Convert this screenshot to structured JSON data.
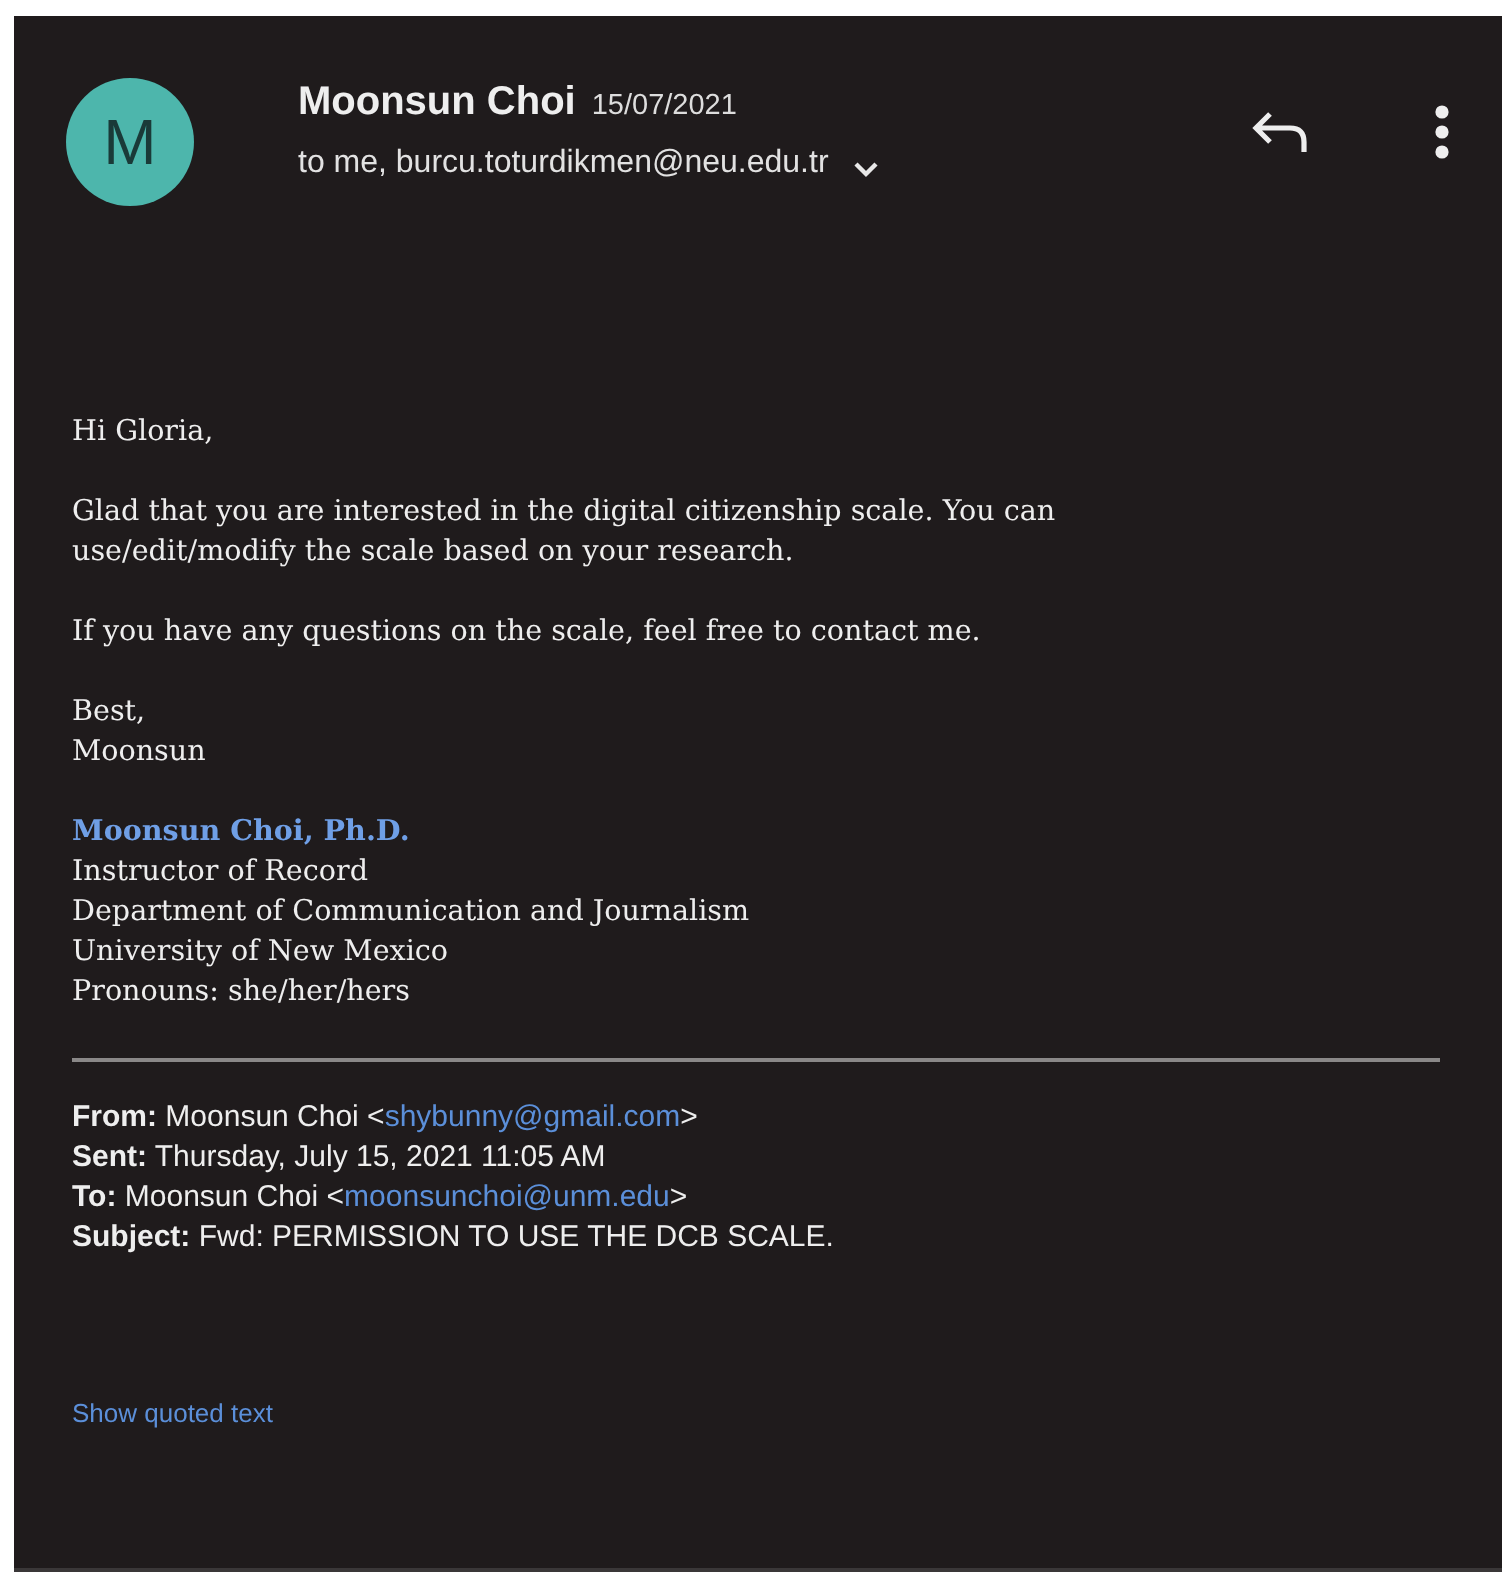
{
  "header": {
    "avatar_letter": "M",
    "sender": "Moonsun Choi",
    "date": "15/07/2021",
    "recipients": "to me, burcu.toturdikmen@neu.edu.tr"
  },
  "body": [
    [
      "Hi Gloria,"
    ],
    [
      "Glad that you are interested in the digital citizenship scale. You can",
      "use/edit/modify the scale based on your research."
    ],
    [
      "If you have any questions on the scale, feel free to contact me."
    ],
    [
      "Best,",
      "Moonsun"
    ]
  ],
  "signature": {
    "name": "Moonsun Choi, Ph.D.",
    "lines": [
      "Instructor of Record",
      "Department of Communication and Journalism",
      "University of New Mexico",
      "Pronouns: she/her/hers"
    ]
  },
  "forwarded": [
    {
      "label": "From:",
      "value": "Moonsun Choi <",
      "email": "shybunny@gmail.com",
      "after": ">"
    },
    {
      "label": "Sent:",
      "value": "Thursday, July 15, 2021 11:05 AM"
    },
    {
      "label": "To:",
      "value": "Moonsun Choi <",
      "email": "moonsunchoi@unm.edu",
      "after": ">"
    },
    {
      "label": "Subject:",
      "value": "Fwd: PERMISSION TO USE THE DCB SCALE."
    }
  ],
  "show_quoted": "Show quoted text"
}
